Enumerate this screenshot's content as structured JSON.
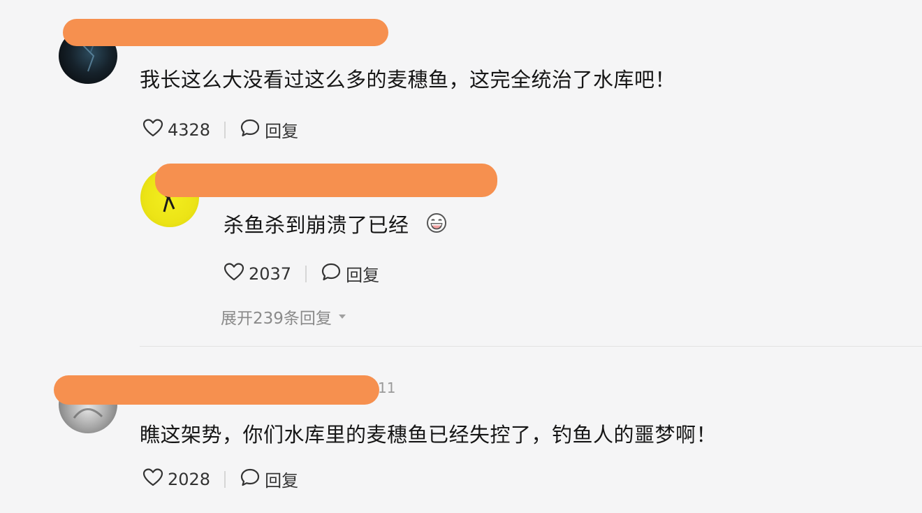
{
  "comments": [
    {
      "text": "我长这么大没看过这么多的麦穗鱼，这完全统治了水库吧！",
      "likes": "4328",
      "reply_label": "回复"
    },
    {
      "text": "杀鱼杀到崩溃了已经",
      "likes": "2037",
      "reply_label": "回复",
      "expand_label": "展开239条回复"
    },
    {
      "time_fragment": "11",
      "text": "瞧这架势，你们水库里的麦穗鱼已经失控了，钓鱼人的噩梦啊！",
      "likes": "2028",
      "reply_label": "回复"
    }
  ],
  "icons": {
    "like": "heart-outline-icon",
    "reply": "speech-bubble-icon",
    "emoji": "grinning-face-icon",
    "expand": "caret-down-icon"
  },
  "colors": {
    "background": "#f5f5f6",
    "redaction": "#f6904f"
  }
}
